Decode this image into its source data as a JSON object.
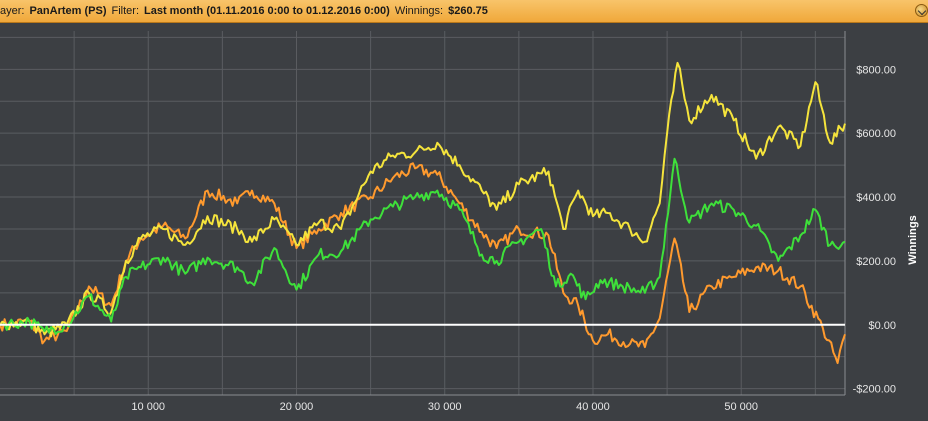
{
  "header": {
    "player_label": "ayer:",
    "player_value": "PanArtem (PS)",
    "filter_label": "Filter:",
    "filter_value": "Last month (01.11.2016 0:00 to 01.12.2016 0:00)",
    "winnings_label": "Winnings:",
    "winnings_value": "$260.75",
    "icon": "chevron-down-icon"
  },
  "chart_data": {
    "type": "line",
    "xlabel": "",
    "ylabel": "Winnings",
    "xlim": [
      0,
      57000
    ],
    "ylim": [
      -220,
      920
    ],
    "x_ticks": [
      10000,
      20000,
      30000,
      40000,
      50000
    ],
    "x_tick_labels": [
      "10 000",
      "20 000",
      "30 000",
      "40 000",
      "50 000"
    ],
    "y_ticks": [
      800,
      600,
      400,
      200,
      0,
      -200
    ],
    "y_tick_labels": [
      "$800.00",
      "$600.00",
      "$400.00",
      "$200.00",
      "$0.00",
      "-$200.00"
    ],
    "grid": true,
    "zero_line": true,
    "colors": {
      "background": "#3c3f43",
      "grid": "#5a5d61",
      "zero_line": "#ffffff"
    },
    "series": [
      {
        "color": "#ff9a2e",
        "x": [
          0,
          2000,
          3000,
          4500,
          6000,
          7500,
          8500,
          9500,
          11000,
          12500,
          14000,
          16000,
          17000,
          18500,
          20000,
          21500,
          23000,
          25000,
          26500,
          28000,
          29500,
          31000,
          32500,
          33500,
          35000,
          37000,
          38000,
          39000,
          40000,
          41000,
          42500,
          43500,
          44500,
          45500,
          46500,
          48000,
          49500,
          51000,
          52500,
          54000,
          55500,
          56500,
          57000
        ],
        "y": [
          0,
          10,
          -50,
          -20,
          120,
          60,
          200,
          270,
          310,
          270,
          420,
          380,
          420,
          380,
          240,
          300,
          350,
          400,
          460,
          490,
          470,
          380,
          290,
          240,
          300,
          280,
          100,
          60,
          -50,
          -30,
          -60,
          -70,
          20,
          270,
          40,
          120,
          150,
          180,
          170,
          120,
          -10,
          -120,
          -30
        ]
      },
      {
        "color": "#f5e43c",
        "x": [
          0,
          2000,
          3000,
          4500,
          6000,
          7500,
          8500,
          9500,
          11000,
          12500,
          14000,
          16000,
          17000,
          18500,
          20000,
          21500,
          23000,
          25000,
          26500,
          28000,
          29500,
          31000,
          32500,
          33500,
          35000,
          37000,
          38000,
          39000,
          40000,
          41000,
          42500,
          43500,
          44500,
          45000,
          45700,
          46500,
          48000,
          49500,
          51000,
          52500,
          54000,
          55000,
          56000,
          57000
        ],
        "y": [
          0,
          10,
          -30,
          0,
          100,
          40,
          200,
          270,
          300,
          250,
          340,
          300,
          260,
          330,
          250,
          320,
          300,
          480,
          530,
          540,
          570,
          500,
          420,
          360,
          440,
          480,
          300,
          420,
          340,
          350,
          300,
          260,
          380,
          600,
          820,
          640,
          720,
          640,
          520,
          620,
          560,
          760,
          570,
          630
        ]
      },
      {
        "color": "#3ee03a",
        "x": [
          0,
          2000,
          3000,
          4500,
          6000,
          7500,
          8500,
          9500,
          11000,
          12500,
          14000,
          16000,
          17000,
          18500,
          20000,
          21500,
          23000,
          25000,
          26500,
          28000,
          29500,
          31000,
          32500,
          33500,
          35000,
          36500,
          37500,
          38500,
          39500,
          40500,
          42000,
          43500,
          44500,
          45500,
          46500,
          48000,
          49500,
          51000,
          52500,
          54000,
          55000,
          56000,
          57000
        ],
        "y": [
          0,
          10,
          -20,
          0,
          90,
          10,
          150,
          180,
          210,
          160,
          210,
          180,
          130,
          240,
          110,
          220,
          230,
          330,
          370,
          400,
          420,
          360,
          220,
          200,
          260,
          300,
          120,
          160,
          80,
          140,
          120,
          100,
          150,
          520,
          320,
          380,
          360,
          310,
          200,
          280,
          360,
          250,
          260
        ]
      }
    ]
  }
}
